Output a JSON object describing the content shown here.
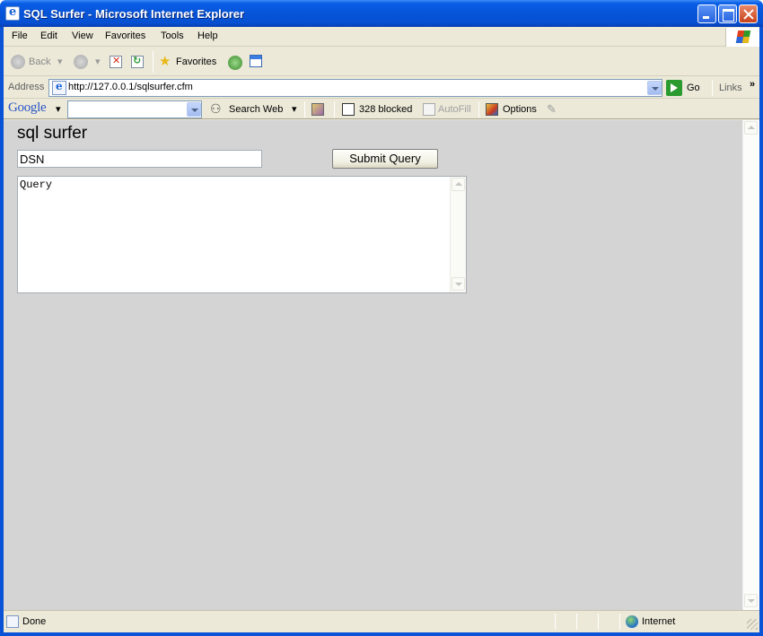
{
  "window": {
    "title": "SQL Surfer - Microsoft Internet Explorer"
  },
  "menu": {
    "items": [
      "File",
      "Edit",
      "View",
      "Favorites",
      "Tools",
      "Help"
    ]
  },
  "toolbar": {
    "back_label": "Back",
    "favorites_label": "Favorites"
  },
  "address": {
    "label": "Address",
    "url": "http://127.0.0.1/sqlsurfer.cfm",
    "go_label": "Go",
    "links_label": "Links"
  },
  "google_toolbar": {
    "logo": "Google",
    "search_web_label": "Search Web",
    "popups_blocked_label": "328 blocked",
    "autofill_label": "AutoFill",
    "options_label": "Options"
  },
  "page": {
    "title": "sql surfer",
    "dsn_value": "DSN",
    "submit_label": "Submit Query",
    "query_value": "Query"
  },
  "status": {
    "text": "Done",
    "zone": "Internet"
  },
  "colors": {
    "titlebar": "#0654d8",
    "content_bg": "#d4d4d4",
    "chrome_bg": "#ece9d8"
  }
}
